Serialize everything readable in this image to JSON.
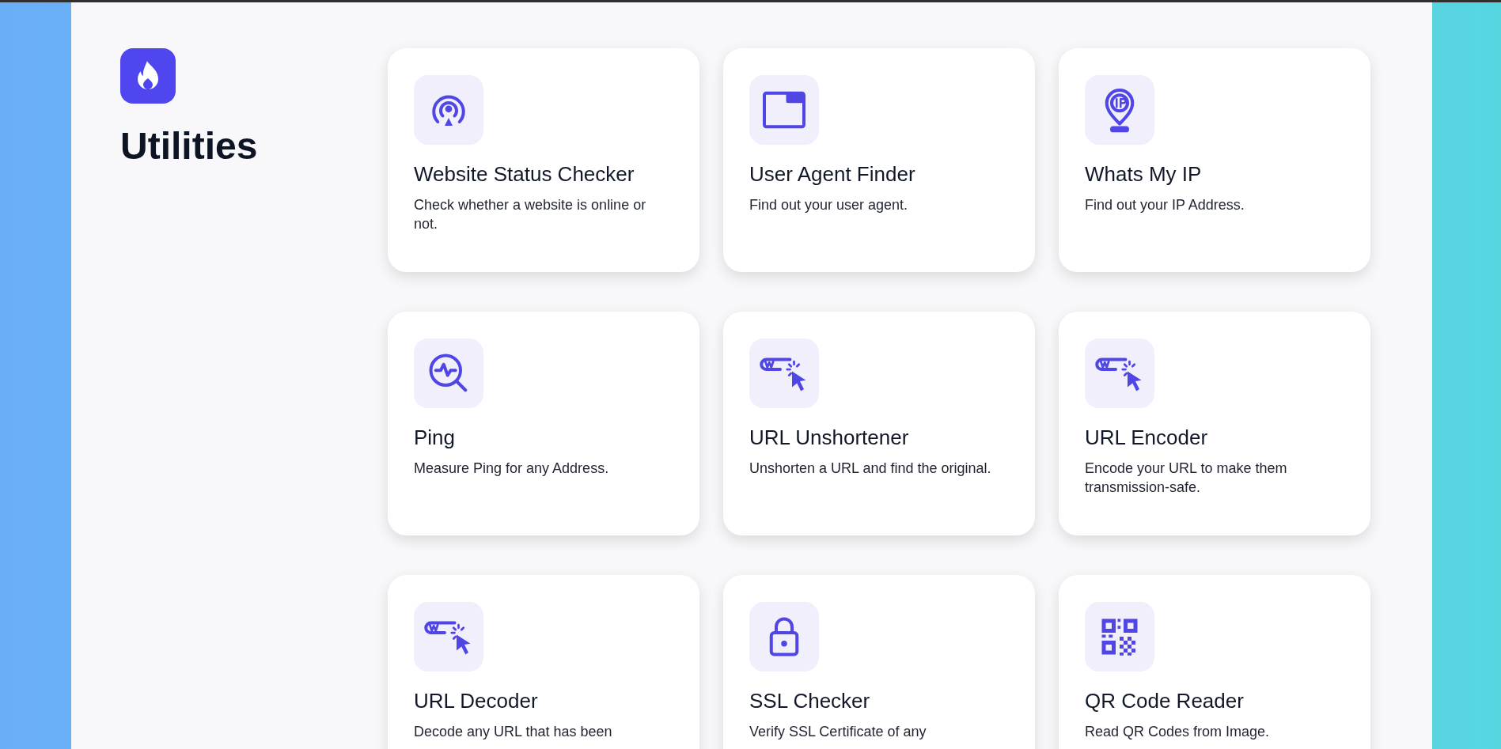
{
  "heading": "Utilities",
  "tools": [
    {
      "kind": "broadcast",
      "title": "Website Status Checker",
      "description": "Check whether a website is online or not."
    },
    {
      "kind": "window",
      "title": "User Agent Finder",
      "description": "Find out your user agent."
    },
    {
      "kind": "ip",
      "title": "Whats My IP",
      "description": "Find out your IP Address."
    },
    {
      "kind": "ping",
      "title": "Ping",
      "description": "Measure Ping for any Address."
    },
    {
      "kind": "link",
      "title": "URL Unshortener",
      "description": "Unshorten a URL and find the original."
    },
    {
      "kind": "link",
      "title": "URL Encoder",
      "description": "Encode your URL to make them transmission-safe."
    },
    {
      "kind": "link",
      "title": "URL Decoder",
      "description": "Decode any URL that has been"
    },
    {
      "kind": "lock",
      "title": "SSL Checker",
      "description": "Verify SSL Certificate of any"
    },
    {
      "kind": "qr",
      "title": "QR Code Reader",
      "description": "Read QR Codes from Image."
    }
  ]
}
